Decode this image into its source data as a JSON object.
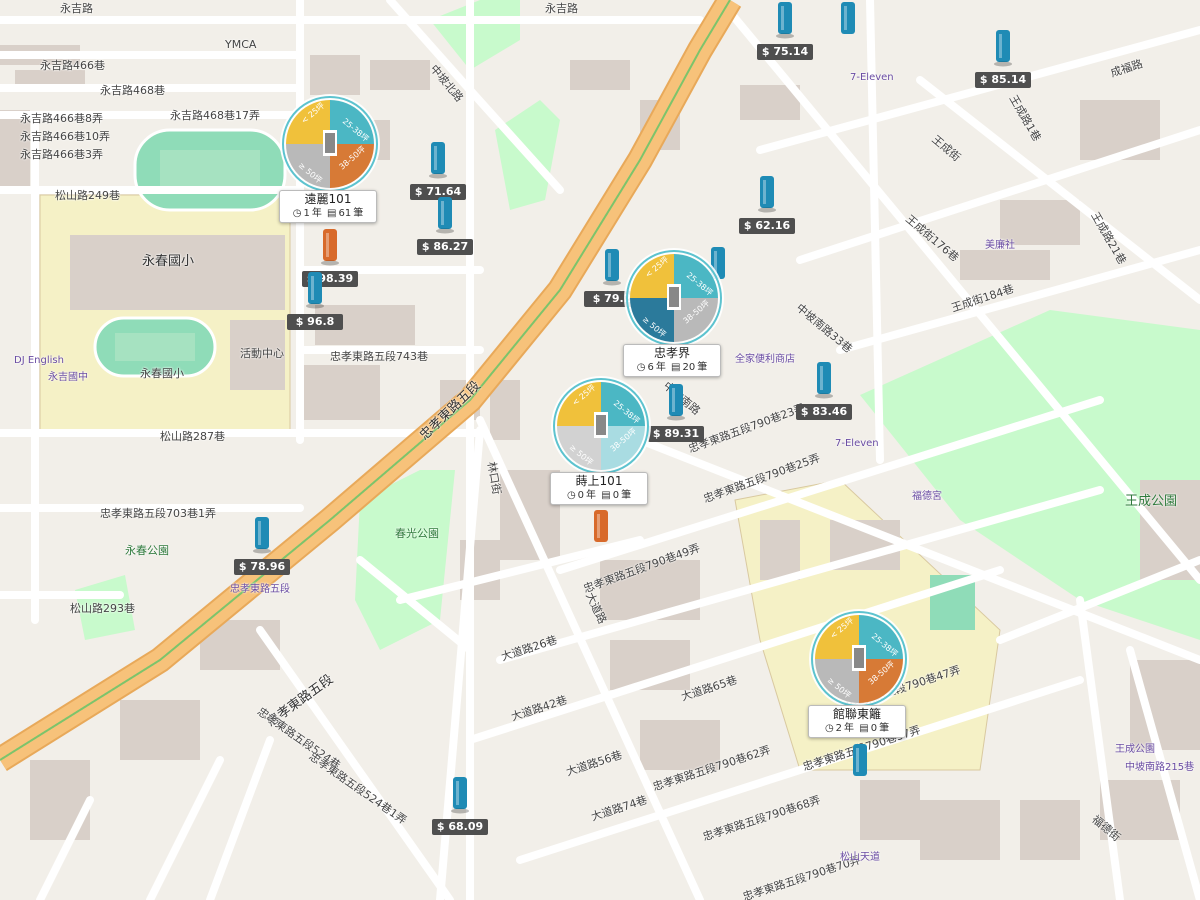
{
  "map": {
    "street_labels": [
      {
        "text": "永吉路",
        "cls": ""
      },
      {
        "text": "永吉路",
        "cls": ""
      },
      {
        "text": "永吉路466巷",
        "cls": ""
      },
      {
        "text": "永吉路468巷",
        "cls": ""
      },
      {
        "text": "永吉路468巷17弄",
        "cls": ""
      },
      {
        "text": "松山路249巷",
        "cls": ""
      },
      {
        "text": "永吉路466巷8弄",
        "cls": ""
      },
      {
        "text": "永吉路466巷10弄",
        "cls": ""
      },
      {
        "text": "永吉路466巷3弄",
        "cls": ""
      },
      {
        "text": "松山路287巷",
        "cls": ""
      },
      {
        "text": "松山路293巷",
        "cls": ""
      },
      {
        "text": "忠孝東路五段",
        "cls": "big"
      },
      {
        "text": "忠孝東路五段",
        "cls": "big"
      },
      {
        "text": "忠孝東路五段743巷",
        "cls": ""
      },
      {
        "text": "忠孝東路五段703巷1弄",
        "cls": ""
      },
      {
        "text": "忠孝東路五段790巷23弄",
        "cls": ""
      },
      {
        "text": "忠孝東路五段790巷25弄",
        "cls": ""
      },
      {
        "text": "忠孝東路五段790巷49弄",
        "cls": ""
      },
      {
        "text": "忠孝東路五段790巷47弄",
        "cls": ""
      },
      {
        "text": "忠孝東路五段790巷57弄",
        "cls": ""
      },
      {
        "text": "忠孝東路五段790巷62弄",
        "cls": ""
      },
      {
        "text": "忠孝東路五段790巷68弄",
        "cls": ""
      },
      {
        "text": "忠孝東路五段790巷70弄",
        "cls": ""
      },
      {
        "text": "忠孝東路五段524巷",
        "cls": ""
      },
      {
        "text": "忠孝東路五段524巷1弄",
        "cls": ""
      },
      {
        "text": "中坡北路",
        "cls": ""
      },
      {
        "text": "中坡南路",
        "cls": ""
      },
      {
        "text": "王成街",
        "cls": ""
      },
      {
        "text": "林口街",
        "cls": ""
      },
      {
        "text": "大道路",
        "cls": ""
      },
      {
        "text": "大道路26巷",
        "cls": ""
      },
      {
        "text": "大道路42巷",
        "cls": ""
      },
      {
        "text": "大道路56巷",
        "cls": ""
      },
      {
        "text": "大道路65巷",
        "cls": ""
      },
      {
        "text": "大道路74巷",
        "cls": ""
      },
      {
        "text": "福德街",
        "cls": ""
      },
      {
        "text": "成福路",
        "cls": ""
      },
      {
        "text": "王成路1巷",
        "cls": ""
      },
      {
        "text": "王成路21巷",
        "cls": ""
      },
      {
        "text": "王成街176巷",
        "cls": ""
      },
      {
        "text": "王成街184巷",
        "cls": ""
      },
      {
        "text": "中坡南路33巷",
        "cls": ""
      }
    ],
    "area_labels": [
      {
        "text": "永春國小",
        "cls": "big"
      },
      {
        "text": "永春國小",
        "cls": ""
      },
      {
        "text": "活動中心",
        "cls": ""
      },
      {
        "text": "王成公園",
        "cls": "big green"
      },
      {
        "text": "春光公園",
        "cls": "green"
      },
      {
        "text": "永春公園",
        "cls": "green"
      },
      {
        "text": "YMCA",
        "cls": ""
      },
      {
        "text": "7-Eleven",
        "cls": "poi"
      },
      {
        "text": "7-Eleven",
        "cls": "poi"
      },
      {
        "text": "福德宮",
        "cls": "poi"
      },
      {
        "text": "松山天道",
        "cls": "poi"
      },
      {
        "text": "王成公園",
        "cls": "poi"
      },
      {
        "text": "全家便利商店",
        "cls": "poi"
      },
      {
        "text": "美廉社",
        "cls": "poi"
      },
      {
        "text": "DJ English",
        "cls": "poi"
      },
      {
        "text": "永吉國中",
        "cls": "poi"
      },
      {
        "text": "忠孝東路五段",
        "cls": "poi"
      },
      {
        "text": "中坡南路215巷",
        "cls": "poi"
      }
    ],
    "price_markers": [
      {
        "price": "$ 75.14",
        "color": "#1f8bb5"
      },
      {
        "price": "$ 85.14",
        "color": "#1f8bb5"
      },
      {
        "price": "$ 71.64",
        "color": "#1f8bb5"
      },
      {
        "price": "$ 86.27",
        "color": "#1f8bb5"
      },
      {
        "price": "$ 98.39",
        "color": "#d86a2b"
      },
      {
        "price": "$ 96.8",
        "color": "#1f8bb5"
      },
      {
        "price": "$ 62.16",
        "color": "#1f8bb5"
      },
      {
        "price": "$ 79.2",
        "color": "#1f8bb5"
      },
      {
        "price": "$ 83.46",
        "color": "#1f8bb5"
      },
      {
        "price": "$ 89.31",
        "color": "#1f8bb5"
      },
      {
        "price": "$ 78.96",
        "color": "#1f8bb5"
      },
      {
        "price": "$ 68.09",
        "color": "#1f8bb5"
      }
    ],
    "building_icons_no_price": [
      {
        "color": "#1f8bb5"
      },
      {
        "color": "#1f8bb5"
      },
      {
        "color": "#d86a2b"
      },
      {
        "color": "#1f8bb5"
      }
    ],
    "clusters": [
      {
        "name": "遠麗101",
        "years": "1",
        "records": "61",
        "segments": [
          "< 25坪",
          "25-38坪",
          "38-50坪",
          "≥ 50坪"
        ]
      },
      {
        "name": "忠孝界",
        "years": "6",
        "records": "20",
        "segments": [
          "< 25坪",
          "25-38坪",
          "38-50坪",
          "≥ 50坪"
        ]
      },
      {
        "name": "蒔上101",
        "years": "0",
        "records": "0",
        "segments": [
          "< 25坪",
          "25-38坪",
          "38-50坪",
          "≥ 50坪"
        ]
      },
      {
        "name": "館聯東籬",
        "years": "2",
        "records": "0",
        "segments": [
          "< 25坪",
          "25-38坪",
          "38-50坪",
          "≥ 50坪"
        ]
      }
    ],
    "cluster_units": {
      "year": "年",
      "record": "筆"
    },
    "colors": {
      "land": "#f2efe9",
      "park": "#c8facc",
      "school": "#f5f1c6",
      "building": "#d9d0c9",
      "primary_road": "#f7c27a",
      "minor_road": "#ffffff",
      "seg_lt25": "#f0c13b",
      "seg_25_38": "#4bb7c4",
      "seg_38_50": "#d77a36",
      "seg_ge50": "#b9b9b9",
      "blue_building": "#1f8bb5",
      "orange_building": "#d86a2b"
    }
  }
}
